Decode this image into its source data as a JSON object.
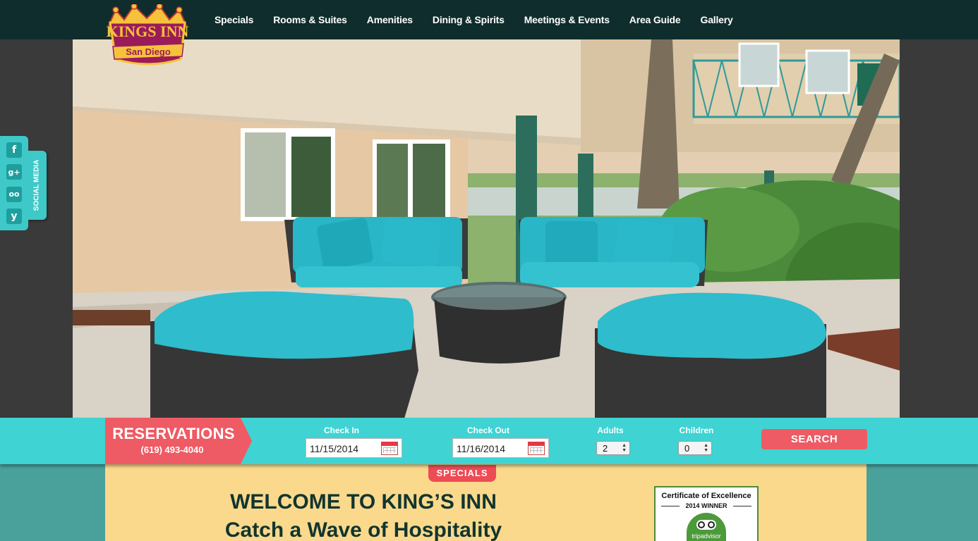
{
  "header": {
    "logo_main": "KINGS INN",
    "logo_sub": "San Diego",
    "nav": [
      {
        "label": "Specials"
      },
      {
        "label": "Rooms & Suites"
      },
      {
        "label": "Amenities"
      },
      {
        "label": "Dining & Spirits"
      },
      {
        "label": "Meetings & Events"
      },
      {
        "label": "Area Guide"
      },
      {
        "label": "Gallery"
      }
    ]
  },
  "social": {
    "label": "SOCIAL MEDIA",
    "icons": [
      {
        "name": "facebook-icon",
        "glyph": "f"
      },
      {
        "name": "google-plus-icon",
        "glyph": "g+"
      },
      {
        "name": "tripadvisor-icon",
        "glyph": "oo"
      },
      {
        "name": "yelp-icon",
        "glyph": "y"
      }
    ]
  },
  "reservations": {
    "title": "RESERVATIONS",
    "phone": "(619) 493-4040",
    "check_in_label": "Check In",
    "check_in_value": "11/15/2014",
    "check_out_label": "Check Out",
    "check_out_value": "11/16/2014",
    "adults_label": "Adults",
    "adults_value": "2",
    "children_label": "Children",
    "children_value": "0",
    "search_label": "SEARCH"
  },
  "content": {
    "specials_tab": "SPECIALS",
    "welcome": "WELCOME TO KING’S INN",
    "tagline": "Catch a Wave of Hospitality",
    "certificate_title": "Certificate of Excellence",
    "certificate_year": "2014 WINNER",
    "certificate_brand": "tripadvisor"
  },
  "colors": {
    "header_bg": "#0f2d2c",
    "accent_teal": "#3fd3d3",
    "accent_red": "#ee5b64",
    "content_bg": "#fbd98c"
  }
}
